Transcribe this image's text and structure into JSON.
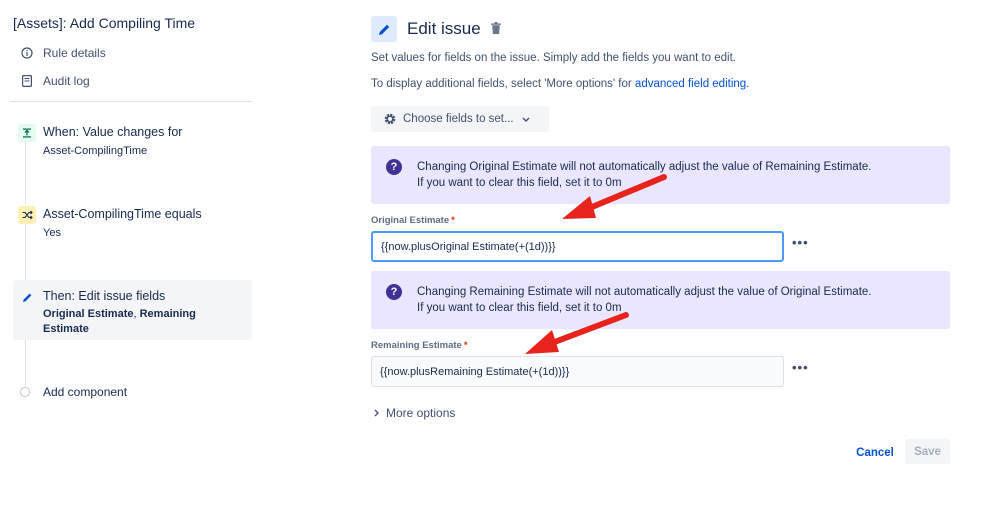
{
  "rule": {
    "title": "[Assets]: Add Compiling Time",
    "links": [
      {
        "label": "Rule details",
        "icon": "info-icon"
      },
      {
        "label": "Audit log",
        "icon": "document-icon"
      }
    ]
  },
  "steps": [
    {
      "title": "When: Value changes for",
      "sub": "Asset-CompilingTime",
      "icon": "trigger-icon",
      "color": "#e3fcef"
    },
    {
      "title": "Asset-CompilingTime equals",
      "sub": "Yes",
      "icon": "condition-icon",
      "color": "#fff0b3"
    },
    {
      "title": "Then: Edit issue fields",
      "sub_bold_1": "Original Estimate",
      "sub_sep": ", ",
      "sub_bold_2": "Remaining",
      "sub_bold_3": "Estimate",
      "icon": "pencil-icon",
      "color": "#deebff"
    }
  ],
  "add_component": "Add component",
  "edit": {
    "title": "Edit issue",
    "desc1": "Set values for fields on the issue. Simply add the fields you want to edit.",
    "desc2_prefix": "To display additional fields, select 'More options' for ",
    "desc2_link": "advanced field editing",
    "desc2_suffix": ".",
    "choose_label": "Choose fields to set..."
  },
  "info1": {
    "line1": "Changing Original Estimate will not automatically adjust the value of Remaining Estimate.",
    "line2": "If you want to clear this field, set it to 0m"
  },
  "info2": {
    "line1": "Changing Remaining Estimate will not automatically adjust the value of Original Estimate.",
    "line2": "If you want to clear this field, set it to 0m"
  },
  "fields": {
    "original_label": "Original Estimate",
    "original_value": "{{now.plusOriginal Estimate(+(1d))}}",
    "remaining_label": "Remaining Estimate",
    "remaining_value": "{{now.plusRemaining Estimate(+(1d))}}",
    "required_mark": "*"
  },
  "more_options": "More options",
  "actions": {
    "cancel": "Cancel",
    "save": "Save"
  },
  "colors": {
    "accent": "#0052cc",
    "arrow": "#e8221c",
    "info_bg": "#eae6ff"
  }
}
